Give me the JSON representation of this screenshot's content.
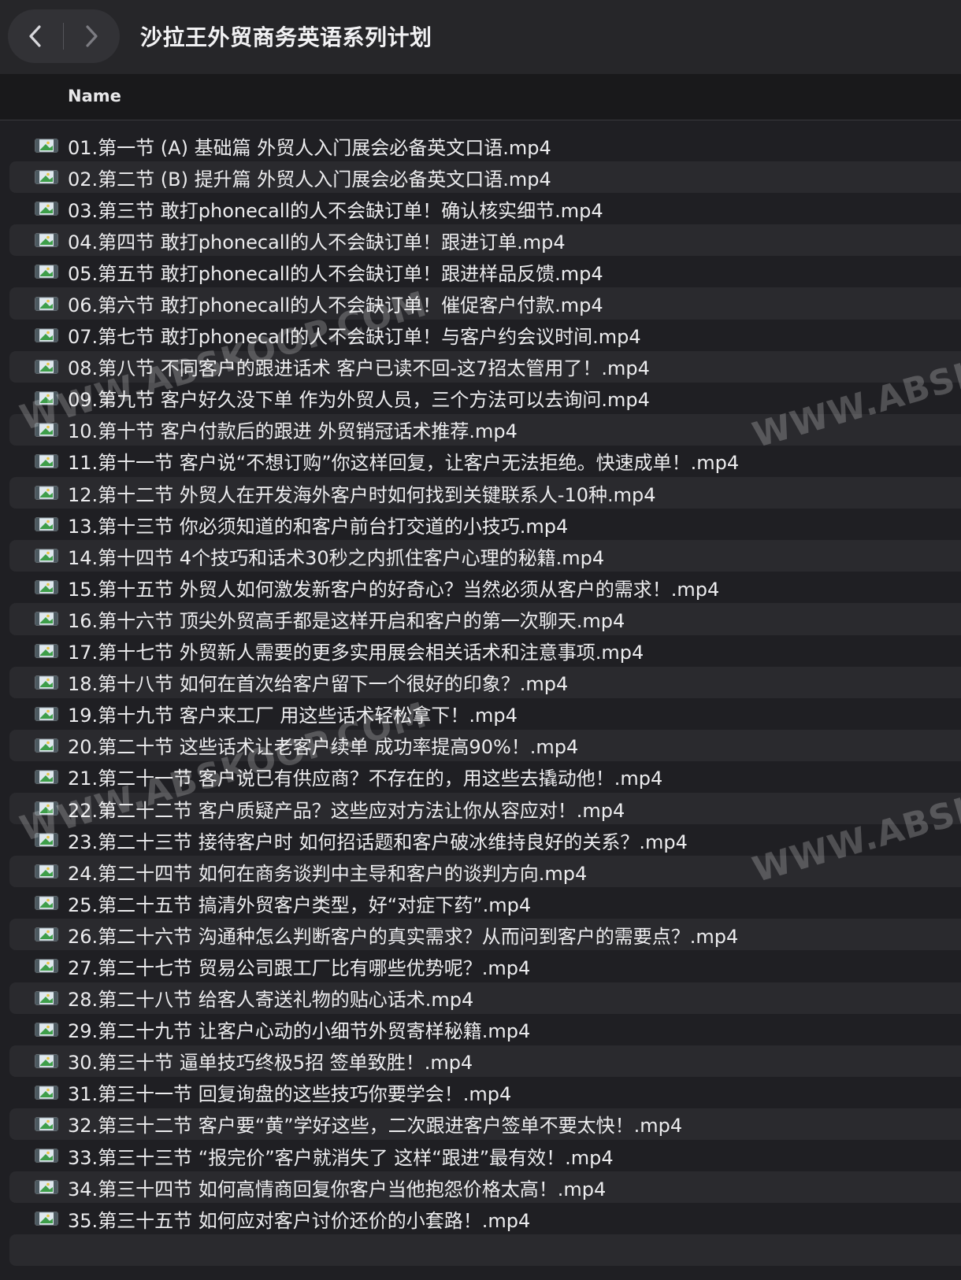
{
  "window": {
    "title": "沙拉王外贸商务英语系列计划"
  },
  "columns": {
    "name": "Name"
  },
  "icons": {
    "back": "chevron-left-icon",
    "forward": "chevron-right-icon",
    "file": "video-file-icon"
  },
  "watermark": "WWW.ABSKOOP.COM",
  "files": [
    "01.第一节 (A) 基础篇 外贸人入门展会必备英文口语.mp4",
    "02.第二节 (B) 提升篇 外贸人入门展会必备英文口语.mp4",
    "03.第三节 敢打phonecall的人不会缺订单！确认核实细节.mp4",
    "04.第四节 敢打phonecall的人不会缺订单！跟进订单.mp4",
    "05.第五节 敢打phonecall的人不会缺订单！跟进样品反馈.mp4",
    "06.第六节 敢打phonecall的人不会缺订单！催促客户付款.mp4",
    "07.第七节 敢打phonecall的人不会缺订单！与客户约会议时间.mp4",
    "08.第八节 不同客户的跟进话术 客户已读不回-这7招太管用了！.mp4",
    "09.第九节 客户好久没下单 作为外贸人员，三个方法可以去询问.mp4",
    "10.第十节 客户付款后的跟进 外贸销冠话术推荐.mp4",
    "11.第十一节 客户说“不想订购”你这样回复，让客户无法拒绝。快速成单！.mp4",
    "12.第十二节 外贸人在开发海外客户时如何找到关键联系人-10种.mp4",
    "13.第十三节 你必须知道的和客户前台打交道的小技巧.mp4",
    "14.第十四节 4个技巧和话术30秒之内抓住客户心理的秘籍.mp4",
    "15.第十五节 外贸人如何激发新客户的好奇心？当然必须从客户的需求！.mp4",
    "16.第十六节 顶尖外贸高手都是这样开启和客户的第一次聊天.mp4",
    "17.第十七节 外贸新人需要的更多实用展会相关话术和注意事项.mp4",
    "18.第十八节 如何在首次给客户留下一个很好的印象？.mp4",
    "19.第十九节 客户来工厂 用这些话术轻松拿下！.mp4",
    "20.第二十节 这些话术让老客户续单 成功率提高90%！.mp4",
    "21.第二十一节 客户说已有供应商？不存在的，用这些去撬动他！.mp4",
    "22.第二十二节 客户质疑产品？这些应对方法让你从容应对！.mp4",
    "23.第二十三节 接待客户时 如何招话题和客户破冰维持良好的关系？.mp4",
    "24.第二十四节 如何在商务谈判中主导和客户的谈判方向.mp4",
    "25.第二十五节 搞清外贸客户类型，好“对症下药”.mp4",
    "26.第二十六节 沟通种怎么判断客户的真实需求？从而问到客户的需要点？.mp4",
    "27.第二十七节 贸易公司跟工厂比有哪些优势呢？.mp4",
    "28.第二十八节 给客人寄送礼物的贴心话术.mp4",
    "29.第二十九节 让客户心动的小细节外贸寄样秘籍.mp4",
    "30.第三十节 逼单技巧终极5招 签单致胜！.mp4",
    "31.第三十一节 回复询盘的这些技巧你要学会！.mp4",
    "32.第三十二节 客户要“黄”学好这些，二次跟进客户签单不要太快！.mp4",
    "33.第三十三节 “报完价”客户就消失了 这样“跟进”最有效！.mp4",
    "34.第三十四节 如何高情商回复你客户当他抱怨价格太高！.mp4",
    "35.第三十五节 如何应对客户讨价还价的小套路！.mp4"
  ]
}
